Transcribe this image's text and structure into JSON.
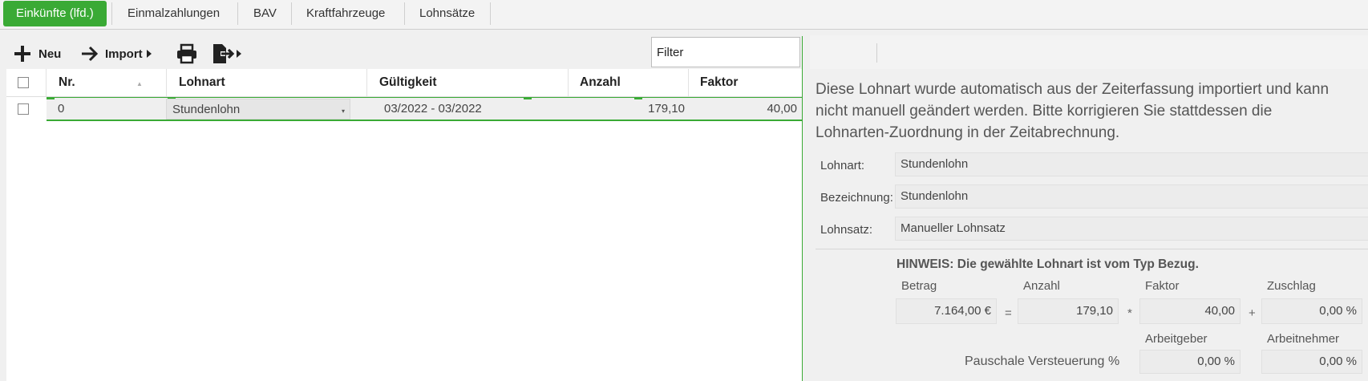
{
  "tabs": [
    {
      "label": "Einkünfte (lfd.)",
      "active": true
    },
    {
      "label": "Einmalzahlungen"
    },
    {
      "label": "BAV"
    },
    {
      "label": "Kraftfahrzeuge"
    },
    {
      "label": "Lohnsätze"
    }
  ],
  "toolbar": {
    "new_label": "Neu",
    "import_label": "Import",
    "filter_placeholder": "Filter"
  },
  "grid": {
    "columns": [
      "Nr.",
      "Lohnart",
      "Gültigkeit",
      "Anzahl",
      "Faktor"
    ],
    "rows": [
      {
        "nr": "0",
        "lohnart": "Stundenlohn",
        "gueltigkeit": "03/2022 - 03/2022",
        "anzahl": "179,10",
        "faktor": "40,00"
      }
    ]
  },
  "detail": {
    "notice": "Diese Lohnart wurde automatisch aus der Zeiterfassung importiert und kann nicht manuell geändert werden. Bitte korrigieren Sie stattdessen die Lohnarten-Zuordnung in der Zeitabrechnung.",
    "lohnart_label": "Lohnart:",
    "lohnart_value": "Stundenlohn",
    "bezeichnung_label": "Bezeichnung:",
    "bezeichnung_value": "Stundenlohn",
    "lohnsatz_label": "Lohnsatz:",
    "lohnsatz_value": "Manueller Lohnsatz",
    "hinweis": "HINWEIS: Die gewählte Lohnart ist vom Typ Bezug.",
    "calc": {
      "betrag_label": "Betrag",
      "betrag_value": "7.164,00 €",
      "anzahl_label": "Anzahl",
      "anzahl_value": "179,10",
      "faktor_label": "Faktor",
      "faktor_value": "40,00",
      "zuschlag_label": "Zuschlag",
      "zuschlag_value": "0,00 %",
      "op_eq": "=",
      "op_mul": "*",
      "op_plus": "+"
    },
    "pauschale": {
      "label": "Pauschale Versteuerung",
      "percent_sign": "%",
      "arbeitgeber_label": "Arbeitgeber",
      "arbeitgeber_value": "0,00 %",
      "arbeitnehmer_label": "Arbeitnehmer",
      "arbeitnehmer_value": "0,00 %"
    }
  },
  "colors": {
    "accent": "#3aaa35"
  }
}
